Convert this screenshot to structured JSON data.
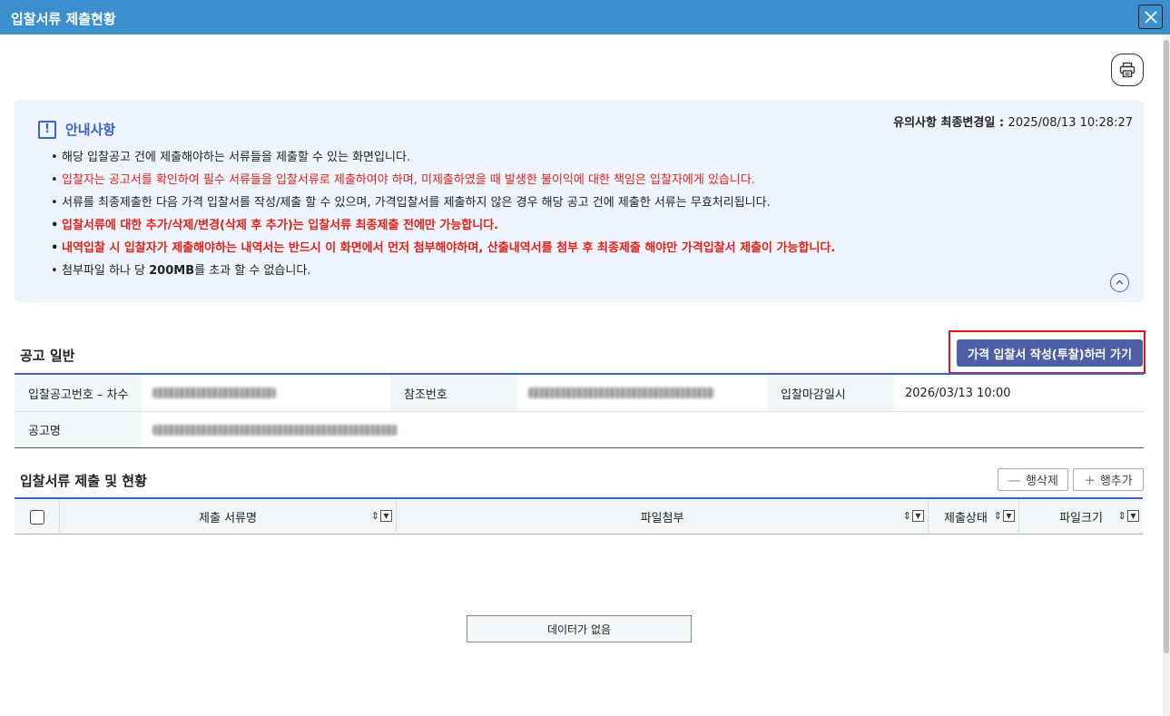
{
  "window": {
    "title": "입찰서류 제출현황"
  },
  "notice": {
    "title": "안내사항",
    "updated_label": "유의사항 최종변경일 :",
    "updated_date": "2025/08/13 10:28:27",
    "items": [
      {
        "text": "해당 입찰공고 건에 제출해야하는 서류들을 제출할 수 있는 화면입니다."
      },
      {
        "text": "입찰자는 공고서를 확인하여 필수 서류들을 입찰서류로 제출하여야 하며, 미제출하였을 때 발생한 불이익에 대한 책임은 입찰자에게 있습니다."
      },
      {
        "text": "서류를 최종제출한 다음 가격 입찰서를 작성/제출 할 수 있으며, 가격입찰서를 제출하지 않은 경우 해당 공고 건에 제출한 서류는 무효처리됩니다."
      },
      {
        "text": "입찰서류에 대한 추가/삭제/변경(삭제 후 추가)는 입찰서류 최종제출 전에만 가능합니다."
      },
      {
        "text": "내역입찰 시 입찰자가 제출해야하는 내역서는 반드시 이 화면에서 먼저 첨부해야하며, 산출내역서를 첨부 후 최종제출 해야만 가격입찰서 제출이 가능합니다."
      },
      {
        "text_pre": "첨부파일 하나 당 ",
        "text_bold": "200MB",
        "text_post": "를 초과 할 수 없습니다."
      }
    ]
  },
  "general": {
    "title": "공고 일반",
    "bid_button": "가격 입찰서 작성(투찰)하러 가기",
    "fields": {
      "notice_no_label": "입찰공고번호 – 차수",
      "ref_no_label": "참조번호",
      "deadline_label": "입찰마감일시",
      "deadline_value": "2026/03/13 10:00",
      "name_label": "공고명"
    }
  },
  "docs": {
    "title": "입찰서류 제출 및 현황",
    "delete_row": "행삭제",
    "add_row": "행추가",
    "columns": [
      "제출 서류명",
      "파일첨부",
      "제출상태",
      "파일크기"
    ],
    "empty_text": "데이터가 없음"
  },
  "colors": {
    "titlebar": "#3c8fcf",
    "accent": "#3a64c8",
    "bid_button": "#4c5fa7",
    "highlight_border": "#e0151b",
    "warning_text": "#e0221a"
  }
}
